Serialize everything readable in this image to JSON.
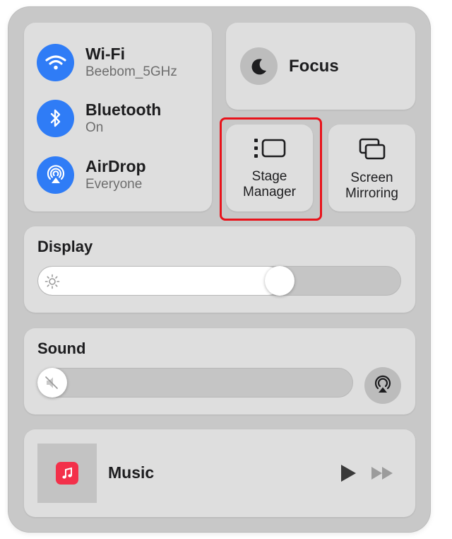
{
  "connectivity": {
    "items": [
      {
        "id": "wifi",
        "title": "Wi-Fi",
        "subtitle": "Beebom_5GHz"
      },
      {
        "id": "bluetooth",
        "title": "Bluetooth",
        "subtitle": "On"
      },
      {
        "id": "airdrop",
        "title": "AirDrop",
        "subtitle": "Everyone"
      }
    ]
  },
  "focus": {
    "label": "Focus"
  },
  "stage_manager": {
    "line1": "Stage",
    "line2": "Manager"
  },
  "screen_mirroring": {
    "line1": "Screen",
    "line2": "Mirroring"
  },
  "display": {
    "label": "Display",
    "brightness_fraction": 0.68
  },
  "sound": {
    "label": "Sound",
    "volume_fraction": 0.0
  },
  "now_playing": {
    "app": "Music"
  },
  "colors": {
    "accent": "#2f7cf6",
    "highlight": "#e8131b",
    "music_icon": "#f3304a"
  },
  "icons": [
    "wifi-icon",
    "bluetooth-icon",
    "airdrop-icon",
    "moon-icon",
    "stage-manager-icon",
    "screen-mirroring-icon",
    "sun-icon",
    "mute-icon",
    "airplay-audio-icon",
    "music-note-icon",
    "play-icon",
    "fast-forward-icon"
  ]
}
